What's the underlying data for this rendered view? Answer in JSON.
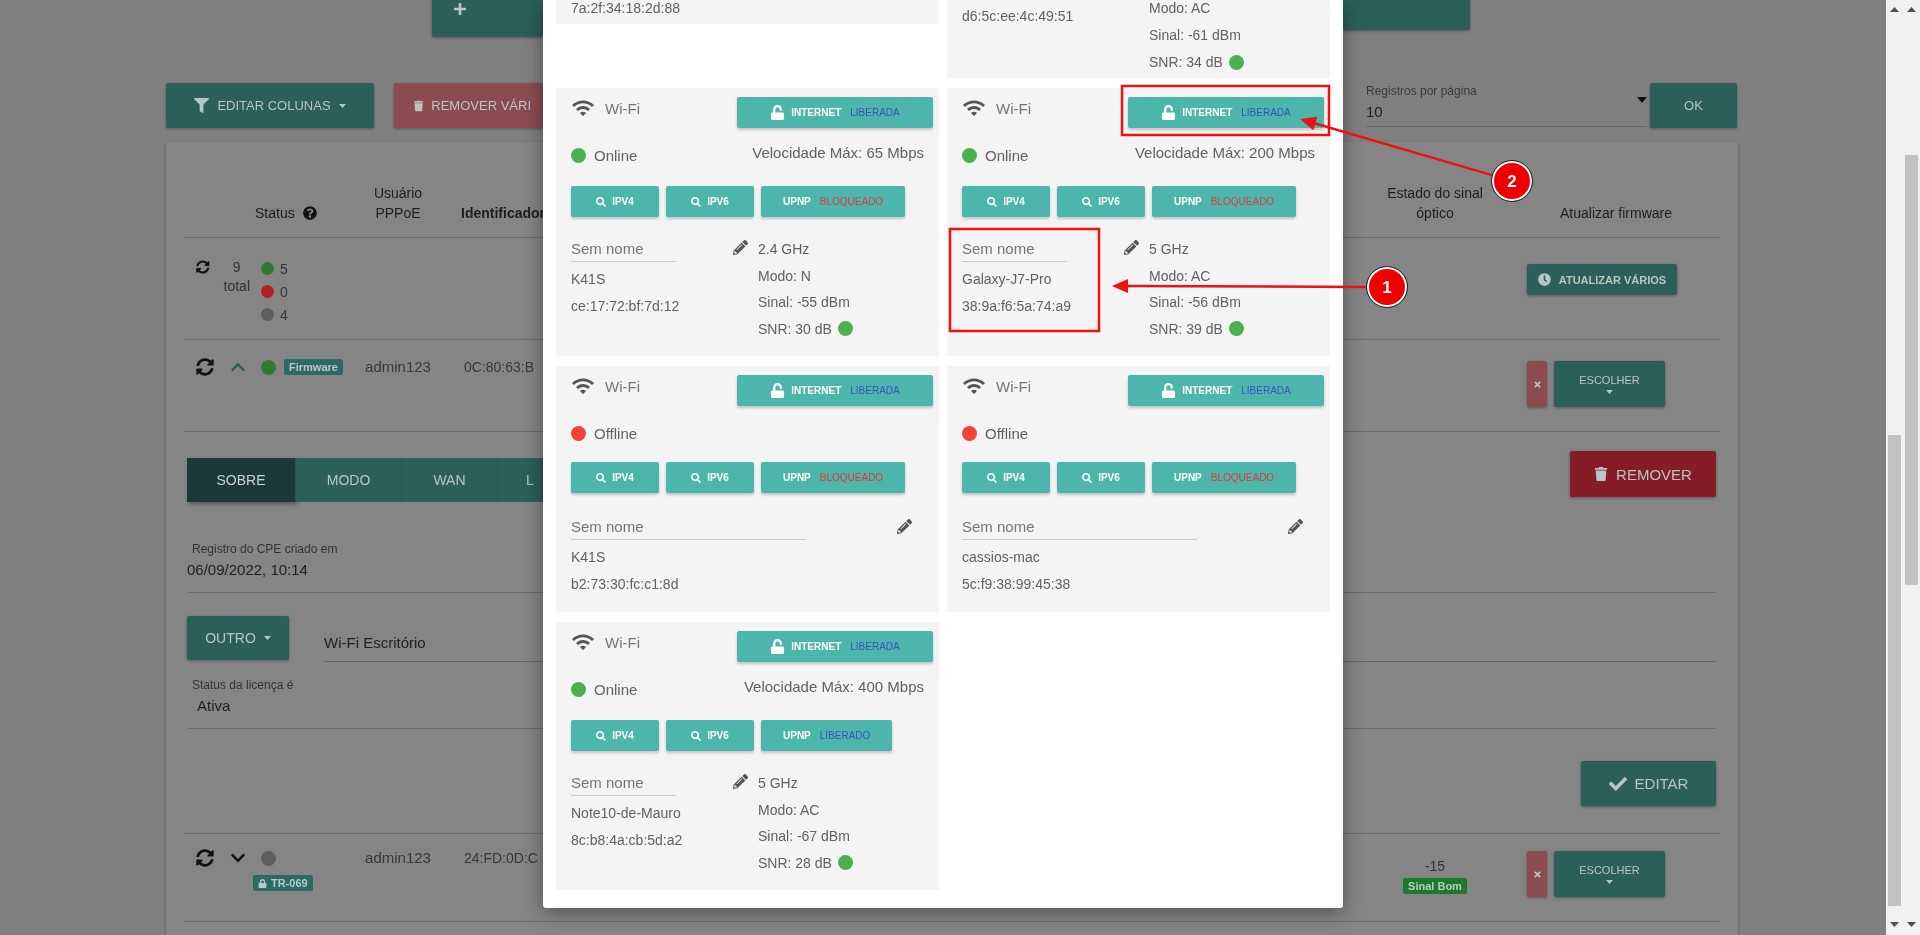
{
  "top_bar": {
    "edit_columns": "EDITAR COLUNAS",
    "remove_many": "REMOVER VÁRI",
    "per_page_label": "Registros por página",
    "per_page_value": "10",
    "ok": "OK"
  },
  "table": {
    "columns": [
      {
        "label": "Status"
      },
      {
        "label": "Usuário PPPoE"
      },
      {
        "label": "Identificador"
      },
      {
        "label": "Estado do sinal óptico"
      },
      {
        "label": "Atualizar firmware"
      }
    ],
    "summary": {
      "total": "9",
      "total_label": "total",
      "counts": [
        {
          "value": "5",
          "color": "#2e7a30"
        },
        {
          "value": "0",
          "color": "#b0231f"
        },
        {
          "value": "4",
          "color": "#5e5e5e"
        }
      ],
      "update_all": "ATUALIZAR VÁRIOS"
    },
    "rows": [
      {
        "expanded": true,
        "color": "#2e7a30",
        "badge": {
          "kind": "firmware",
          "label": "Firmware"
        },
        "user": "admin123",
        "identifier": "0C:80:63:B",
        "firmware_choice": "ESCOLHER"
      },
      {
        "expanded": false,
        "color": "#5e5e5e",
        "badge": {
          "kind": "tr069",
          "label": "TR-069"
        },
        "user": "admin123",
        "identifier": "24:FD:0D:C",
        "optical_signal": "-15",
        "signal_status": "Sinal Bom",
        "firmware_choice": "ESCOLHER"
      }
    ]
  },
  "details": {
    "tabs": [
      {
        "label": "SOBRE",
        "selected": true
      },
      {
        "label": "MODO",
        "selected": false
      },
      {
        "label": "WAN",
        "selected": false
      },
      {
        "label": "L",
        "selected": false
      }
    ],
    "remove": "REMOVER",
    "created_label": "Registro do CPE criado em",
    "created_value": "06/09/2022, 10:14",
    "mode_button": "OUTRO",
    "ssid": "Wi-Fi Escritório",
    "license_label": "Status da licença é",
    "license_value": "Ativa",
    "edit": "EDITAR"
  },
  "modal": {
    "partial_cards": [
      {
        "mac": "7a:2f:34:18:2d:88"
      },
      {
        "mac": "d6:5c:ee:4c:49:51",
        "mode": "Modo: AC",
        "signal": "Sinal: -61 dBm",
        "snr": "SNR: 34 dB",
        "snr_good": true
      }
    ],
    "cards": [
      {
        "connection": "Wi-Fi",
        "internet": {
          "label": "INTERNET",
          "state": "LIBERADA"
        },
        "status": "Online",
        "online": true,
        "speed": "Velocidade Máx: 65 Mbps",
        "ipv4": "IPV4",
        "ipv6": "IPV6",
        "upnp": {
          "label": "UPNP",
          "state": "BLOQUEADO",
          "blocked": true
        },
        "name_placeholder": "Sem nome",
        "hostname": "K41S",
        "mac": "ce:17:72:bf:7d:12",
        "band": "2.4 GHz",
        "mode": "Modo: N",
        "signal": "Sinal: -55 dBm",
        "snr": "SNR: 30 dB",
        "snr_good": true
      },
      {
        "connection": "Wi-Fi",
        "internet": {
          "label": "INTERNET",
          "state": "LIBERADA"
        },
        "status": "Online",
        "online": true,
        "speed": "Velocidade Máx: 200 Mbps",
        "ipv4": "IPV4",
        "ipv6": "IPV6",
        "upnp": {
          "label": "UPNP",
          "state": "BLOQUEADO",
          "blocked": true
        },
        "name_placeholder": "Sem nome",
        "hostname": "Galaxy-J7-Pro",
        "mac": "38:9a:f6:5a:74:a9",
        "band": "5 GHz",
        "mode": "Modo: AC",
        "signal": "Sinal: -56 dBm",
        "snr": "SNR: 39 dB",
        "snr_good": true
      },
      {
        "connection": "Wi-Fi",
        "internet": {
          "label": "INTERNET",
          "state": "LIBERADA"
        },
        "status": "Offline",
        "online": false,
        "ipv4": "IPV4",
        "ipv6": "IPV6",
        "upnp": {
          "label": "UPNP",
          "state": "BLOQUEADO",
          "blocked": true
        },
        "name_placeholder": "Sem nome",
        "hostname": "K41S",
        "mac": "b2:73:30:fc:c1:8d"
      },
      {
        "connection": "Wi-Fi",
        "internet": {
          "label": "INTERNET",
          "state": "LIBERADA"
        },
        "status": "Offline",
        "online": false,
        "ipv4": "IPV4",
        "ipv6": "IPV6",
        "upnp": {
          "label": "UPNP",
          "state": "BLOQUEADO",
          "blocked": true
        },
        "name_placeholder": "Sem nome",
        "hostname": "cassios-mac",
        "mac": "5c:f9:38:99:45:38"
      },
      {
        "connection": "Wi-Fi",
        "internet": {
          "label": "INTERNET",
          "state": "LIBERADA"
        },
        "status": "Online",
        "online": true,
        "speed": "Velocidade Máx: 400 Mbps",
        "ipv4": "IPV4",
        "ipv6": "IPV6",
        "upnp": {
          "label": "UPNP",
          "state": "LIBERADO",
          "blocked": false
        },
        "name_placeholder": "Sem nome",
        "hostname": "Note10-de-Mauro",
        "mac": "8c:b8:4a:cb:5d:a2",
        "band": "5 GHz",
        "mode": "Modo: AC",
        "signal": "Sinal: -67 dBm",
        "snr": "SNR: 28 dB",
        "snr_good": true
      }
    ]
  },
  "annotations": [
    {
      "label": "1"
    },
    {
      "label": "2"
    }
  ]
}
